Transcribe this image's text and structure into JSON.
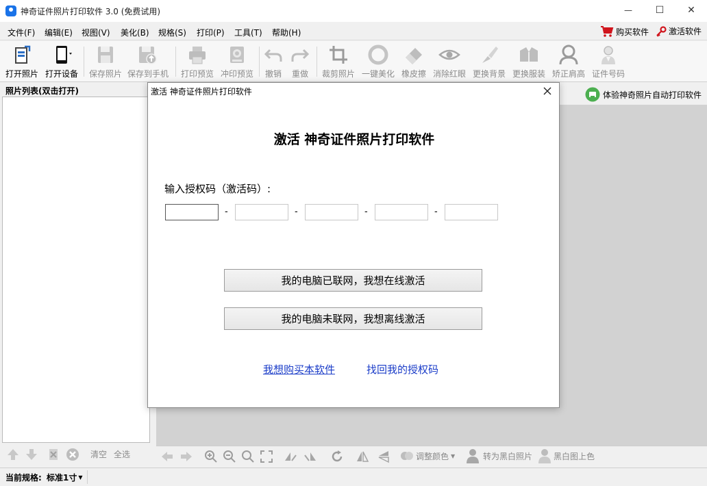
{
  "window": {
    "title": "神奇证件照片打印软件 3.0 (免费试用)",
    "min_glyph": "—",
    "max_glyph": "☐",
    "close_glyph": "✕"
  },
  "menu": {
    "items": [
      "文件(F)",
      "编辑(E)",
      "视图(V)",
      "美化(B)",
      "规格(S)",
      "打印(P)",
      "工具(T)",
      "帮助(H)"
    ],
    "buy": "购买软件",
    "activate": "激活软件"
  },
  "toolbar": {
    "items": [
      {
        "label": "打开照片",
        "icon": "open-photo-icon"
      },
      {
        "label": "打开设备",
        "icon": "open-device-icon"
      },
      {
        "label": "保存照片",
        "icon": "save-photo-icon"
      },
      {
        "label": "保存到手机",
        "icon": "save-to-phone-icon"
      },
      {
        "label": "打印预览",
        "icon": "print-preview-icon"
      },
      {
        "label": "冲印预览",
        "icon": "develop-preview-icon"
      },
      {
        "label": "撤销",
        "icon": "undo-icon"
      },
      {
        "label": "重做",
        "icon": "redo-icon"
      },
      {
        "label": "裁剪照片",
        "icon": "crop-icon"
      },
      {
        "label": "一键美化",
        "icon": "beautify-icon"
      },
      {
        "label": "橡皮擦",
        "icon": "eraser-icon"
      },
      {
        "label": "消除红眼",
        "icon": "red-eye-icon"
      },
      {
        "label": "更换背景",
        "icon": "change-background-icon"
      },
      {
        "label": "更换服装",
        "icon": "change-clothes-icon"
      },
      {
        "label": "矫正肩高",
        "icon": "shoulder-icon"
      },
      {
        "label": "证件号码",
        "icon": "id-number-icon"
      }
    ]
  },
  "left_panel": {
    "title": "照片列表(双击打开)",
    "clear": "清空",
    "select_all": "全选"
  },
  "right_panel": {
    "auto_print": "体验神奇照片自动打印软件"
  },
  "bottom_tools": {
    "adjust_color": "调整颜色",
    "to_bw": "转为黑白照片",
    "bw_color": "黑白图上色"
  },
  "status": {
    "label": "当前规格:",
    "value": "标准1寸"
  },
  "dialog": {
    "title": "激活 神奇证件照片打印软件",
    "heading": "激活 神奇证件照片打印软件",
    "code_label": "输入授权码（激活码）:",
    "dash": "-",
    "codes": [
      "",
      "",
      "",
      "",
      ""
    ],
    "online_button": "我的电脑已联网，我想在线激活",
    "offline_button": "我的电脑未联网，我想离线激活",
    "buy_link": "我想购买本软件",
    "retrieve_link": "找回我的授权码"
  }
}
